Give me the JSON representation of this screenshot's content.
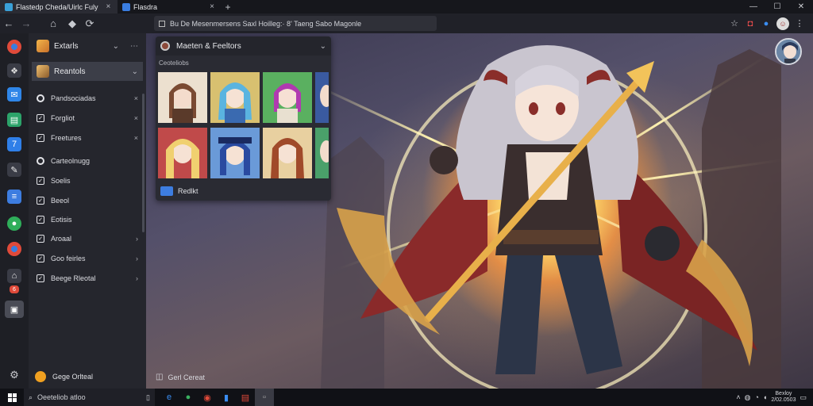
{
  "browser": {
    "tabs": [
      {
        "label": "Flastedp Cheda/Uirlc Fuly",
        "close": "×",
        "favicon": "#3aa0d8"
      },
      {
        "label": "Flasdra",
        "close": "×",
        "favicon": "#3a7de0"
      }
    ],
    "new_tab": "+",
    "address": "Bu De Mesenmersens Saxl Hoilleg:· 8' Taeng Sabo Magonle",
    "window_controls": {
      "minimize": "—",
      "maximize": "☐",
      "close": "✕"
    }
  },
  "nav": {
    "back": "←",
    "forward": "→",
    "home": "⌂",
    "shield": "◆",
    "refresh": "⟳"
  },
  "sidebar": {
    "headers": [
      {
        "label": "Extarls",
        "chev": "⌄",
        "more": "⋯",
        "icon_color": "#e8a03a"
      },
      {
        "label": "Reantols",
        "chev": "⌄",
        "icon_color": "#d89a4a"
      }
    ],
    "items": [
      {
        "label": "Pandsociadas",
        "kind": "circle",
        "arrow": "×"
      },
      {
        "label": "Forgliot",
        "kind": "check",
        "arrow": "×"
      },
      {
        "label": "Freetures",
        "kind": "check",
        "arrow": "×"
      },
      {
        "label": "Carteolnugg",
        "kind": "circle",
        "arrow": ""
      },
      {
        "label": "Soelis",
        "kind": "check",
        "arrow": ""
      },
      {
        "label": "Beeol",
        "kind": "check",
        "arrow": ""
      },
      {
        "label": "Eotisis",
        "kind": "check",
        "arrow": ""
      },
      {
        "label": "Aroaal",
        "kind": "check",
        "arrow": "›"
      },
      {
        "label": "Goo feirles",
        "kind": "check",
        "arrow": "›"
      },
      {
        "label": "Beege Rleotal",
        "kind": "check",
        "arrow": "›"
      }
    ],
    "footer": "Gege Orlteal"
  },
  "card": {
    "title": "Maeten & Feeltors",
    "close": "⌄",
    "subtitle": "Ceoteliobs",
    "footer": "Redlkt"
  },
  "status_strip": {
    "label": "Gerl Cereat"
  },
  "taskbar": {
    "search_placeholder": "Oeeteliob atloo",
    "clock_time": "Bexloy",
    "clock_date": "2/02.0503"
  }
}
